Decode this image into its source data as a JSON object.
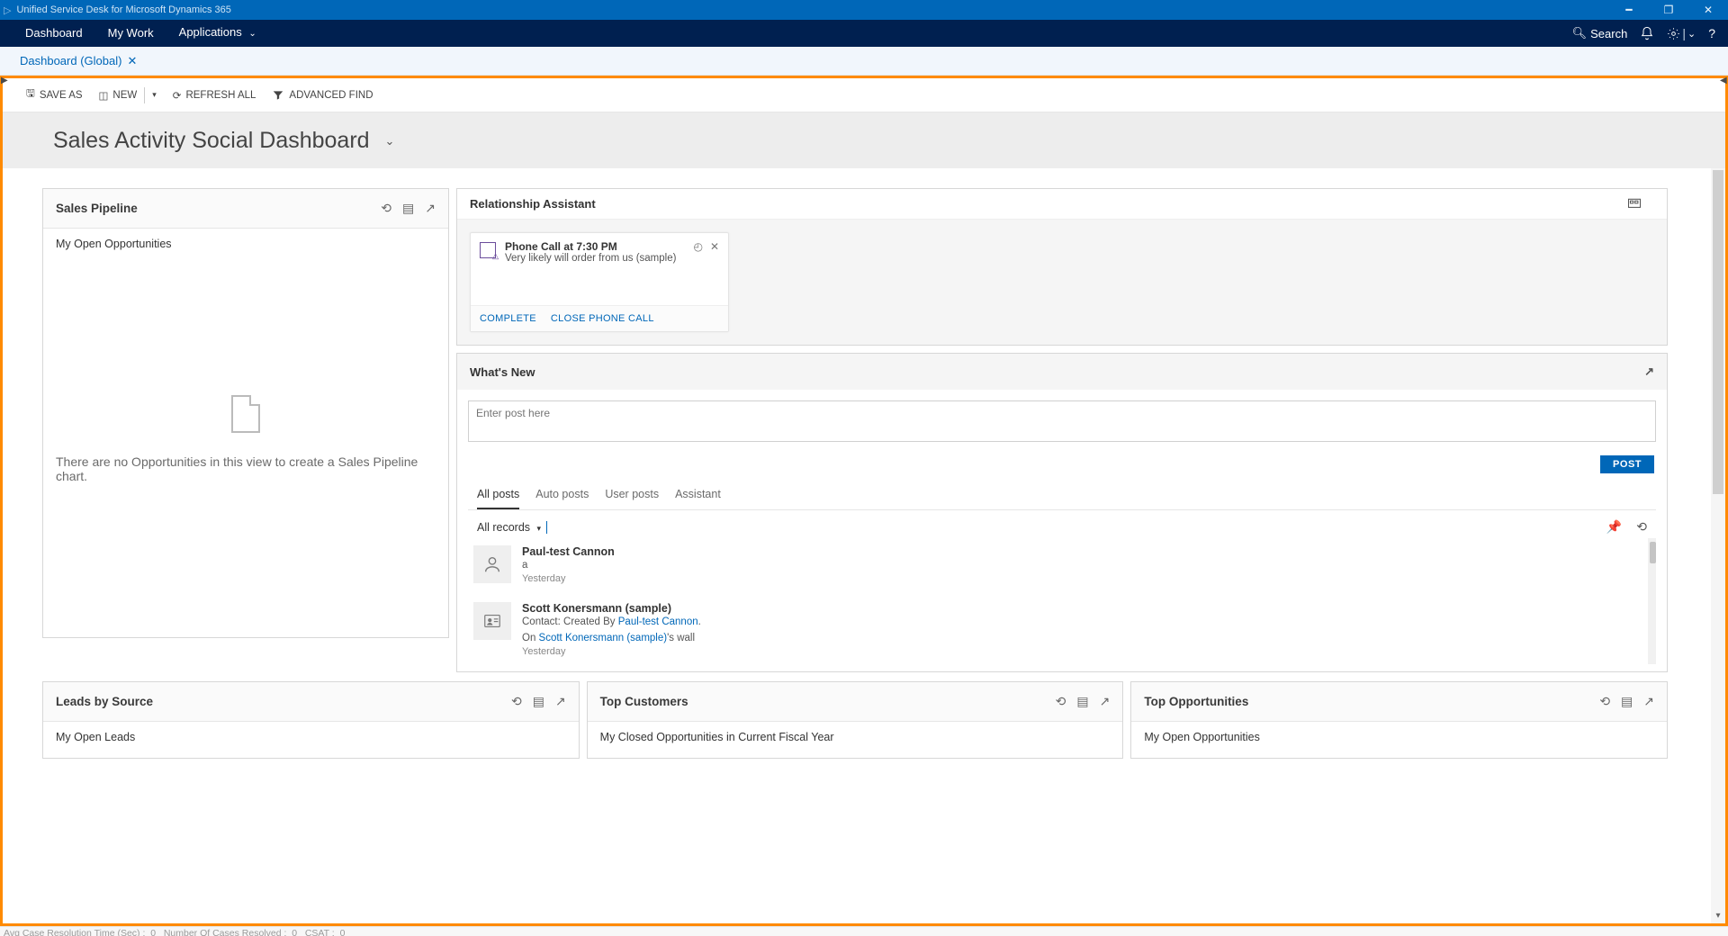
{
  "window": {
    "title": "Unified Service Desk for Microsoft Dynamics 365"
  },
  "nav": {
    "items": [
      "Dashboard",
      "My Work",
      "Applications"
    ],
    "search": "Search"
  },
  "tab": {
    "label": "Dashboard (Global)"
  },
  "toolbar": {
    "save_as": "SAVE AS",
    "new": "NEW",
    "refresh": "REFRESH ALL",
    "adv_find": "ADVANCED FIND"
  },
  "page_title": "Sales Activity Social Dashboard",
  "pipeline": {
    "title": "Sales Pipeline",
    "subtitle": "My Open Opportunities",
    "empty": "There are no Opportunities in this view to create a Sales Pipeline chart."
  },
  "rel_assist": {
    "title": "Relationship Assistant",
    "card_title": "Phone Call at 7:30 PM",
    "card_sub": "Very likely will order from us (sample)",
    "complete": "COMPLETE",
    "close_call": "CLOSE PHONE CALL"
  },
  "whats_new": {
    "title": "What's New",
    "placeholder": "Enter post here",
    "post_btn": "POST",
    "tabs": [
      "All posts",
      "Auto posts",
      "User posts",
      "Assistant"
    ],
    "filter": "All records"
  },
  "posts": {
    "p1_name": "Paul-test Cannon",
    "p1_body": "a",
    "p1_time": "Yesterday",
    "p2_name": "Scott Konersmann (sample)",
    "p2_prefix": "Contact: Created By ",
    "p2_link1": "Paul-test Cannon",
    "p2_mid": "On ",
    "p2_link2": "Scott Konersmann (sample)",
    "p2_suffix": "'s wall",
    "p2_time": "Yesterday"
  },
  "bottom": {
    "leads_title": "Leads by Source",
    "leads_sub": "My Open Leads",
    "cust_title": "Top Customers",
    "cust_sub": "My Closed Opportunities in Current Fiscal Year",
    "opp_title": "Top Opportunities",
    "opp_sub": "My Open Opportunities"
  },
  "status": {
    "avg": "Avg Case Resolution Time (Sec) :",
    "avg_v": "0",
    "num": "Number Of Cases Resolved :",
    "num_v": "0",
    "csat": "CSAT :",
    "csat_v": "0"
  }
}
